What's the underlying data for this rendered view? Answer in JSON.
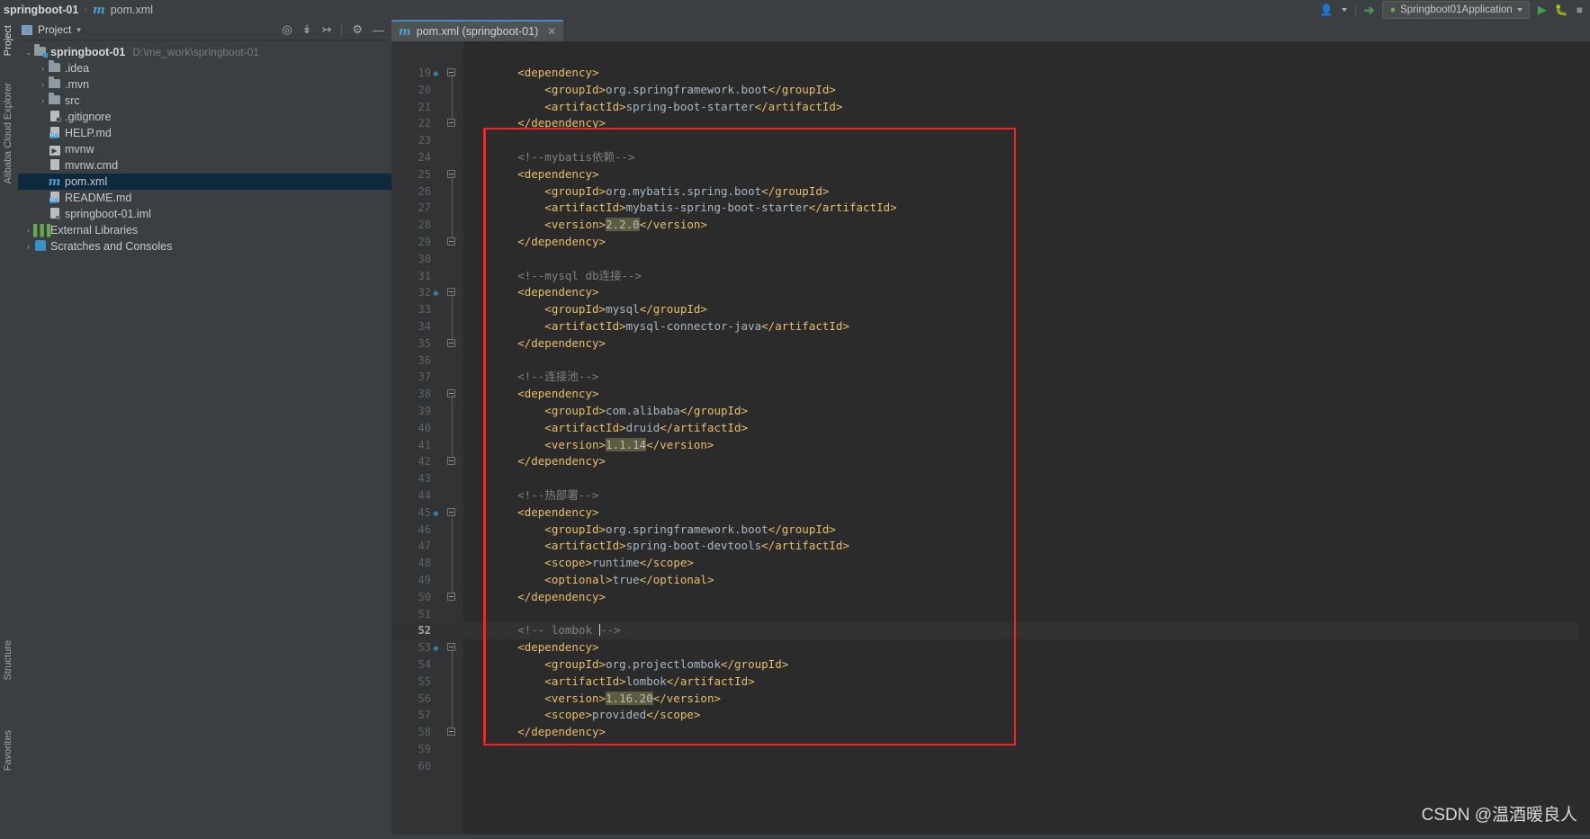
{
  "navbar": {
    "project_name": "springboot-01",
    "separator": "›",
    "file_icon": "m",
    "file_name": "pom.xml",
    "account_icon": "person-icon",
    "hammer_icon": "hammer-icon",
    "run_config": "Springboot01Application",
    "run_config_icon": "spring-leaf-icon",
    "dropdown_caret": "▾",
    "run_icon": "▶",
    "debug_icon": "debug-icon",
    "stop_icon": "stop-icon"
  },
  "left_stripe": {
    "project_label": "Project",
    "explorer_label": "Alibaba Cloud Explorer",
    "structure_label": "Structure",
    "favorites_label": "Favorites"
  },
  "project_panel": {
    "title": "Project",
    "title_caret": "▾",
    "toolbar": [
      {
        "name": "locate-icon",
        "glyph": "⊕"
      },
      {
        "name": "expand-all-icon",
        "glyph": "⤒"
      },
      {
        "name": "collapse-all-icon",
        "glyph": "⤓"
      },
      {
        "name": "settings-gear-icon",
        "glyph": "✱"
      },
      {
        "name": "hide-icon",
        "glyph": "—"
      }
    ],
    "tree": [
      {
        "indent": 0,
        "arrow": "⌄",
        "icon": "folder-module",
        "label": "springboot-01",
        "bold": true,
        "path": "D:\\me_work\\springboot-01",
        "selected": false
      },
      {
        "indent": 1,
        "arrow": "›",
        "icon": "folder",
        "label": ".idea",
        "bold": false,
        "path": "",
        "selected": false
      },
      {
        "indent": 1,
        "arrow": "›",
        "icon": "folder",
        "label": ".mvn",
        "bold": false,
        "path": "",
        "selected": false
      },
      {
        "indent": 1,
        "arrow": "›",
        "icon": "folder",
        "label": "src",
        "bold": false,
        "path": "",
        "selected": false
      },
      {
        "indent": 1,
        "arrow": "",
        "icon": "file-gitignore",
        "label": ".gitignore",
        "bold": false,
        "path": "",
        "selected": false
      },
      {
        "indent": 1,
        "arrow": "",
        "icon": "file-md",
        "label": "HELP.md",
        "bold": false,
        "path": "",
        "selected": false
      },
      {
        "indent": 1,
        "arrow": "",
        "icon": "file-shell",
        "label": "mvnw",
        "bold": false,
        "path": "",
        "selected": false
      },
      {
        "indent": 1,
        "arrow": "",
        "icon": "file-cmd",
        "label": "mvnw.cmd",
        "bold": false,
        "path": "",
        "selected": false
      },
      {
        "indent": 1,
        "arrow": "",
        "icon": "file-maven",
        "label": "pom.xml",
        "bold": false,
        "path": "",
        "selected": true
      },
      {
        "indent": 1,
        "arrow": "",
        "icon": "file-md",
        "label": "README.md",
        "bold": false,
        "path": "",
        "selected": false
      },
      {
        "indent": 1,
        "arrow": "",
        "icon": "file-iml",
        "label": "springboot-01.iml",
        "bold": false,
        "path": "",
        "selected": false
      },
      {
        "indent": 0,
        "arrow": "›",
        "icon": "libraries",
        "label": "External Libraries",
        "bold": false,
        "path": "",
        "selected": false
      },
      {
        "indent": 0,
        "arrow": "›",
        "icon": "scratches",
        "label": "Scratches and Consoles",
        "bold": false,
        "path": "",
        "selected": false
      }
    ]
  },
  "editor": {
    "tab": {
      "icon": "m",
      "label": "pom.xml (springboot-01)",
      "close_glyph": "✕"
    },
    "current_line": 52,
    "first_line": 19,
    "highlight_color": "#5e5c3f",
    "accent_red": "#ff2020",
    "lines": [
      {
        "n": 19,
        "fold": "end",
        "spring": true,
        "segs": [
          {
            "t": "tag",
            "v": "        <dependency>"
          }
        ]
      },
      {
        "n": 20,
        "fold": "",
        "spring": false,
        "segs": [
          {
            "t": "tag",
            "v": "            <groupId>"
          },
          {
            "t": "txt",
            "v": "org.springframework.boot"
          },
          {
            "t": "tag",
            "v": "</groupId>"
          }
        ]
      },
      {
        "n": 21,
        "fold": "",
        "spring": false,
        "segs": [
          {
            "t": "tag",
            "v": "            <artifactId>"
          },
          {
            "t": "txt",
            "v": "spring-boot-starter"
          },
          {
            "t": "tag",
            "v": "</artifactId>"
          }
        ]
      },
      {
        "n": 22,
        "fold": "end",
        "spring": false,
        "segs": [
          {
            "t": "tag",
            "v": "        </dependency>"
          }
        ]
      },
      {
        "n": 23,
        "fold": "",
        "spring": false,
        "segs": []
      },
      {
        "n": 24,
        "fold": "",
        "spring": false,
        "segs": [
          {
            "t": "cmt",
            "v": "        <!--mybatis依赖-->"
          }
        ]
      },
      {
        "n": 25,
        "fold": "start",
        "spring": false,
        "segs": [
          {
            "t": "tag",
            "v": "        <dependency>"
          }
        ]
      },
      {
        "n": 26,
        "fold": "",
        "spring": false,
        "segs": [
          {
            "t": "tag",
            "v": "            <groupId>"
          },
          {
            "t": "txt",
            "v": "org.mybatis.spring.boot"
          },
          {
            "t": "tag",
            "v": "</groupId>"
          }
        ]
      },
      {
        "n": 27,
        "fold": "",
        "spring": false,
        "segs": [
          {
            "t": "tag",
            "v": "            <artifactId>"
          },
          {
            "t": "txt",
            "v": "mybatis-spring-boot-starter"
          },
          {
            "t": "tag",
            "v": "</artifactId>"
          }
        ]
      },
      {
        "n": 28,
        "fold": "",
        "spring": false,
        "segs": [
          {
            "t": "tag",
            "v": "            <version>"
          },
          {
            "t": "hl",
            "v": "2.2.0"
          },
          {
            "t": "tag",
            "v": "</version>"
          }
        ]
      },
      {
        "n": 29,
        "fold": "end",
        "spring": false,
        "segs": [
          {
            "t": "tag",
            "v": "        </dependency>"
          }
        ]
      },
      {
        "n": 30,
        "fold": "",
        "spring": false,
        "segs": []
      },
      {
        "n": 31,
        "fold": "",
        "spring": false,
        "segs": [
          {
            "t": "cmt",
            "v": "        <!--mysql db连接-->"
          }
        ]
      },
      {
        "n": 32,
        "fold": "start",
        "spring": true,
        "segs": [
          {
            "t": "tag",
            "v": "        <dependency>"
          }
        ]
      },
      {
        "n": 33,
        "fold": "",
        "spring": false,
        "segs": [
          {
            "t": "tag",
            "v": "            <groupId>"
          },
          {
            "t": "txt",
            "v": "mysql"
          },
          {
            "t": "tag",
            "v": "</groupId>"
          }
        ]
      },
      {
        "n": 34,
        "fold": "",
        "spring": false,
        "segs": [
          {
            "t": "tag",
            "v": "            <artifactId>"
          },
          {
            "t": "txt",
            "v": "mysql-connector-java"
          },
          {
            "t": "tag",
            "v": "</artifactId>"
          }
        ]
      },
      {
        "n": 35,
        "fold": "end",
        "spring": false,
        "segs": [
          {
            "t": "tag",
            "v": "        </dependency>"
          }
        ]
      },
      {
        "n": 36,
        "fold": "",
        "spring": false,
        "segs": []
      },
      {
        "n": 37,
        "fold": "",
        "spring": false,
        "segs": [
          {
            "t": "cmt",
            "v": "        <!--连接池-->"
          }
        ]
      },
      {
        "n": 38,
        "fold": "start",
        "spring": false,
        "segs": [
          {
            "t": "tag",
            "v": "        <dependency>"
          }
        ]
      },
      {
        "n": 39,
        "fold": "",
        "spring": false,
        "segs": [
          {
            "t": "tag",
            "v": "            <groupId>"
          },
          {
            "t": "txt",
            "v": "com.alibaba"
          },
          {
            "t": "tag",
            "v": "</groupId>"
          }
        ]
      },
      {
        "n": 40,
        "fold": "",
        "spring": false,
        "segs": [
          {
            "t": "tag",
            "v": "            <artifactId>"
          },
          {
            "t": "txt",
            "v": "druid"
          },
          {
            "t": "tag",
            "v": "</artifactId>"
          }
        ]
      },
      {
        "n": 41,
        "fold": "",
        "spring": false,
        "segs": [
          {
            "t": "tag",
            "v": "            <version>"
          },
          {
            "t": "hl",
            "v": "1.1.14"
          },
          {
            "t": "tag",
            "v": "</version>"
          }
        ]
      },
      {
        "n": 42,
        "fold": "end",
        "spring": false,
        "segs": [
          {
            "t": "tag",
            "v": "        </dependency>"
          }
        ]
      },
      {
        "n": 43,
        "fold": "",
        "spring": false,
        "segs": []
      },
      {
        "n": 44,
        "fold": "",
        "spring": false,
        "segs": [
          {
            "t": "cmt",
            "v": "        <!--热部署-->"
          }
        ]
      },
      {
        "n": 45,
        "fold": "start",
        "spring": true,
        "segs": [
          {
            "t": "tag",
            "v": "        <dependency>"
          }
        ]
      },
      {
        "n": 46,
        "fold": "",
        "spring": false,
        "segs": [
          {
            "t": "tag",
            "v": "            <groupId>"
          },
          {
            "t": "txt",
            "v": "org.springframework.boot"
          },
          {
            "t": "tag",
            "v": "</groupId>"
          }
        ]
      },
      {
        "n": 47,
        "fold": "",
        "spring": false,
        "segs": [
          {
            "t": "tag",
            "v": "            <artifactId>"
          },
          {
            "t": "txt",
            "v": "spring-boot-devtools"
          },
          {
            "t": "tag",
            "v": "</artifactId>"
          }
        ]
      },
      {
        "n": 48,
        "fold": "",
        "spring": false,
        "segs": [
          {
            "t": "tag",
            "v": "            <scope>"
          },
          {
            "t": "txt",
            "v": "runtime"
          },
          {
            "t": "tag",
            "v": "</scope>"
          }
        ]
      },
      {
        "n": 49,
        "fold": "",
        "spring": false,
        "segs": [
          {
            "t": "tag",
            "v": "            <optional>"
          },
          {
            "t": "txt",
            "v": "true"
          },
          {
            "t": "tag",
            "v": "</optional>"
          }
        ]
      },
      {
        "n": 50,
        "fold": "end",
        "spring": false,
        "segs": [
          {
            "t": "tag",
            "v": "        </dependency>"
          }
        ]
      },
      {
        "n": 51,
        "fold": "",
        "spring": false,
        "segs": []
      },
      {
        "n": 52,
        "fold": "",
        "spring": false,
        "current": true,
        "segs": [
          {
            "t": "cmt",
            "v": "        <!-- lombok "
          },
          {
            "t": "caret",
            "v": ""
          },
          {
            "t": "cmt",
            "v": "-->"
          }
        ]
      },
      {
        "n": 53,
        "fold": "start",
        "spring": true,
        "segs": [
          {
            "t": "tag",
            "v": "        <dependency>"
          }
        ]
      },
      {
        "n": 54,
        "fold": "",
        "spring": false,
        "segs": [
          {
            "t": "tag",
            "v": "            <groupId>"
          },
          {
            "t": "txt",
            "v": "org.projectlombok"
          },
          {
            "t": "tag",
            "v": "</groupId>"
          }
        ]
      },
      {
        "n": 55,
        "fold": "",
        "spring": false,
        "segs": [
          {
            "t": "tag",
            "v": "            <artifactId>"
          },
          {
            "t": "txt",
            "v": "lombok"
          },
          {
            "t": "tag",
            "v": "</artifactId>"
          }
        ]
      },
      {
        "n": 56,
        "fold": "",
        "spring": false,
        "segs": [
          {
            "t": "tag",
            "v": "            <version>"
          },
          {
            "t": "hl",
            "v": "1.16.20"
          },
          {
            "t": "tag",
            "v": "</version>"
          }
        ]
      },
      {
        "n": 57,
        "fold": "",
        "spring": false,
        "segs": [
          {
            "t": "tag",
            "v": "            <scope>"
          },
          {
            "t": "txt",
            "v": "provided"
          },
          {
            "t": "tag",
            "v": "</scope>"
          }
        ]
      },
      {
        "n": 58,
        "fold": "end",
        "spring": false,
        "segs": [
          {
            "t": "tag",
            "v": "        </dependency>"
          }
        ]
      },
      {
        "n": 59,
        "fold": "",
        "spring": false,
        "segs": []
      },
      {
        "n": 60,
        "fold": "",
        "spring": false,
        "segs": []
      }
    ]
  },
  "watermark": "CSDN @温酒暖良人"
}
